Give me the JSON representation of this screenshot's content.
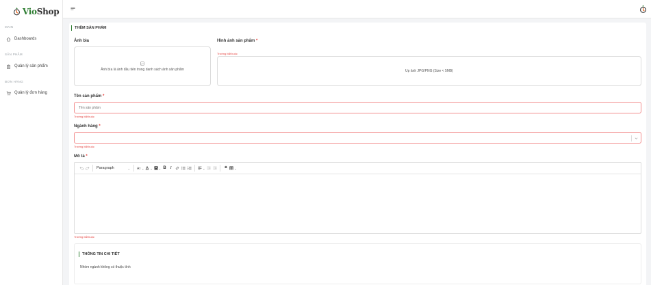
{
  "brand": {
    "name_part1": "Vio",
    "name_part2": "Shop"
  },
  "sidebar": {
    "sections": [
      {
        "title": "MAIN",
        "items": [
          {
            "label": "Dashboards",
            "icon": "home-icon"
          }
        ]
      },
      {
        "title": "SẢN PHẨM",
        "items": [
          {
            "label": "Quản lý sản phẩm",
            "icon": "clipboard-icon"
          }
        ]
      },
      {
        "title": "ĐƠN HÀNG",
        "items": [
          {
            "label": "Quản lý đơn hàng",
            "icon": "cart-icon"
          }
        ]
      }
    ]
  },
  "page": {
    "title": "THÊM SẢN PHẨM"
  },
  "form": {
    "cover": {
      "label": "Ảnh bìa",
      "hint": "Ảnh bìa là ảnh đầu tiên trong danh sách ảnh sản phẩm"
    },
    "images": {
      "label": "Hình ảnh sản phẩm",
      "required_mark": "*",
      "error": "Trường bắt buộc",
      "hint": "Up ảnh JPG/PNG (Size < 5MB)"
    },
    "name": {
      "label": "Tên sản phẩm",
      "required_mark": "*",
      "placeholder": "Tên sản phẩm",
      "error": "Trường bắt buộc"
    },
    "category": {
      "label": "Ngành hàng",
      "required_mark": "*",
      "error": "Trường bắt buộc",
      "value": ""
    },
    "description": {
      "label": "Mô tả",
      "required_mark": "*",
      "error": "Trường bắt buộc",
      "block_format": "Paragraph"
    }
  },
  "details": {
    "title": "THÔNG TIN CHI TIẾT",
    "text": "Nhóm ngành không có thuộc tính"
  },
  "colors": {
    "brand_green": "#2e7d32",
    "error_red": "#e53935",
    "invalid_border": "#f28b8b"
  }
}
